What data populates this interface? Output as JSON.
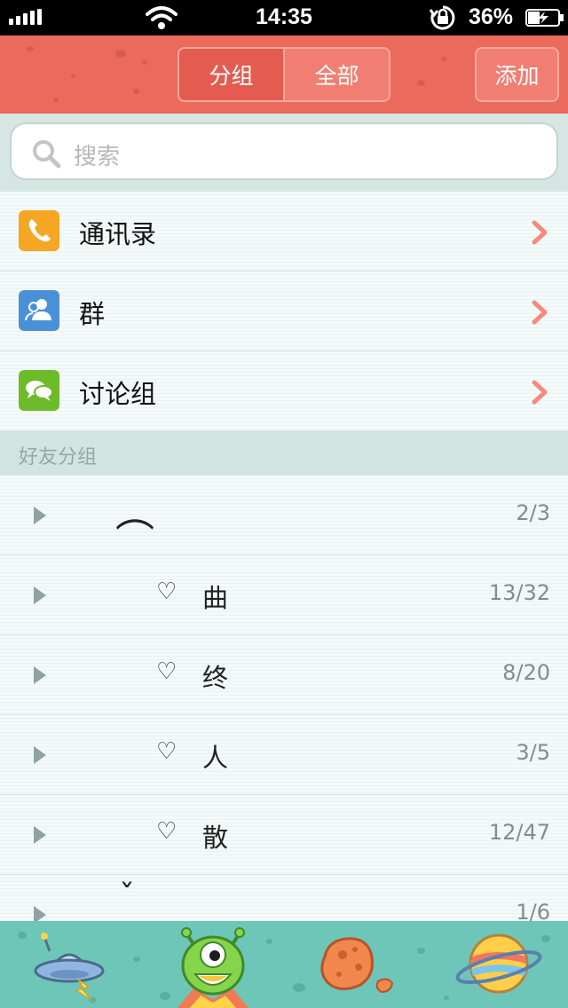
{
  "status_bar": {
    "time": "14:35",
    "battery_percent": "36%",
    "icons": [
      "signal-icon",
      "wifi-icon",
      "rotation-lock-icon",
      "battery-charging-icon"
    ]
  },
  "header": {
    "segments": [
      "分组",
      "全部"
    ],
    "add_label": "添加"
  },
  "search": {
    "placeholder": "搜索",
    "icon": "search-icon"
  },
  "menu": [
    {
      "label": "通讯录",
      "icon": "phone-icon",
      "color": "#f5a623"
    },
    {
      "label": "群",
      "icon": "group-icon",
      "color": "#4a90d9"
    },
    {
      "label": "讨论组",
      "icon": "chat-icon",
      "color": "#6dbb2a"
    }
  ],
  "section_title": "好友分组",
  "groups": [
    {
      "name": "",
      "glyph": "︵",
      "count": "2/3"
    },
    {
      "name": "曲",
      "heart": "♡",
      "count": "13/32"
    },
    {
      "name": "终",
      "heart": "♡",
      "count": "8/20"
    },
    {
      "name": "人",
      "heart": "♡",
      "count": "3/5"
    },
    {
      "name": "散",
      "heart": "♡",
      "count": "12/47"
    },
    {
      "name": "",
      "glyph": "ˇ",
      "count": "1/6"
    }
  ],
  "tabbar": {
    "tabs": [
      "ufo-icon",
      "alien-icon",
      "asteroid-icon",
      "planet-icon"
    ]
  },
  "colors": {
    "header": "#ea6a5c",
    "accent_chevron": "#f08c80",
    "tabbar": "#6ec6b9"
  }
}
